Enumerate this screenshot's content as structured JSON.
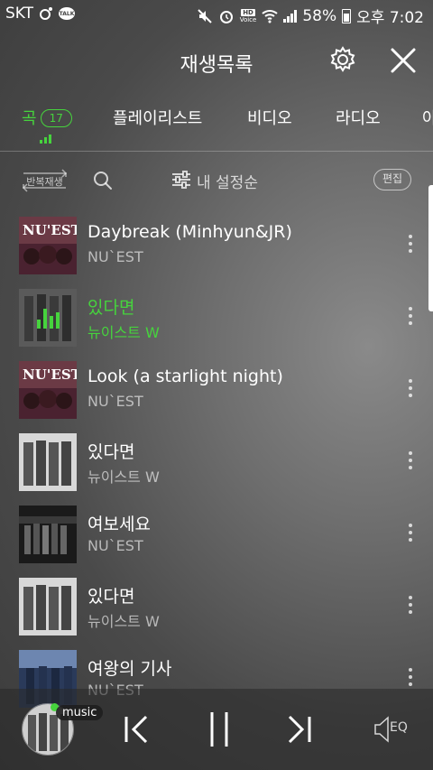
{
  "status_bar": {
    "carrier": "SKT",
    "talk_label": "TALK",
    "hd_label": "HD",
    "voice_label": "Voice",
    "battery": "58%",
    "time": "오후 7:02"
  },
  "header": {
    "title": "재생목록"
  },
  "tabs": [
    {
      "label": "곡",
      "badge": "17",
      "active": true
    },
    {
      "label": "플레이리스트"
    },
    {
      "label": "비디오"
    },
    {
      "label": "라디오"
    },
    {
      "label": "아"
    }
  ],
  "controls": {
    "repeat_label": "반복재생",
    "sort_label": "내 설정순",
    "edit_label": "편집"
  },
  "tracks": [
    {
      "title": "Daybreak (Minhyun&JR)",
      "artist": "NU`EST",
      "art_text": "NU'EST"
    },
    {
      "title": "있다면",
      "artist": "뉴이스트 W",
      "playing": true
    },
    {
      "title": "Look (a starlight night)",
      "artist": "NU`EST",
      "art_text": "NU'EST"
    },
    {
      "title": "있다면",
      "artist": "뉴이스트 W"
    },
    {
      "title": "여보세요",
      "artist": "NU`EST"
    },
    {
      "title": "있다면",
      "artist": "뉴이스트 W"
    },
    {
      "title": "여왕의 기사",
      "artist": "NU`EST"
    }
  ],
  "player": {
    "app_label": "music"
  },
  "colors": {
    "accent": "#46d33d"
  }
}
